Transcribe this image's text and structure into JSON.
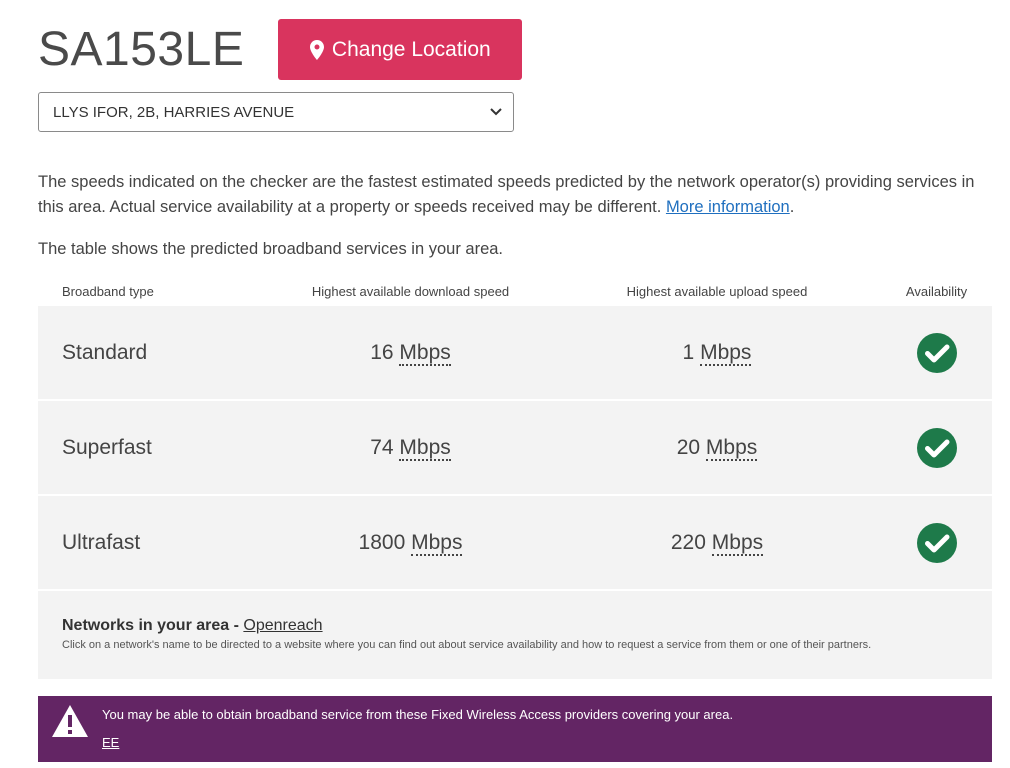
{
  "header": {
    "postcode": "SA153LE",
    "change_location_label": "Change Location"
  },
  "address_select": {
    "selected": "LLYS IFOR, 2B, HARRIES AVENUE"
  },
  "intro": {
    "text": "The speeds indicated on the checker are the fastest estimated speeds predicted by the network operator(s) providing services in this area. Actual service availability at a property or speeds received may be different. ",
    "more_info_link": "More information",
    "period": "."
  },
  "table_caption": "The table shows the predicted broadband services in your area.",
  "table": {
    "headers": [
      "Broadband type",
      "Highest available download speed",
      "Highest available upload speed",
      "Availability"
    ],
    "rows": [
      {
        "type": "Standard",
        "download": "16",
        "download_unit": "Mbps",
        "upload": "1",
        "upload_unit": "Mbps",
        "available": true
      },
      {
        "type": "Superfast",
        "download": "74",
        "download_unit": "Mbps",
        "upload": "20",
        "upload_unit": "Mbps",
        "available": true
      },
      {
        "type": "Ultrafast",
        "download": "1800",
        "download_unit": "Mbps",
        "upload": "220",
        "upload_unit": "Mbps",
        "available": true
      }
    ]
  },
  "networks": {
    "title": "Networks in your area - ",
    "operator": "Openreach",
    "note": "Click on a network's name to be directed to a website where you can find out about service availability and how to request a service from them or one of their partners."
  },
  "warning": {
    "text": "You may be able to obtain broadband service from these Fixed Wireless Access providers covering your area.",
    "provider": "EE"
  },
  "colors": {
    "accent": "#d9345e",
    "check": "#1e7a4a",
    "banner": "#632564",
    "link": "#1f6fbf"
  },
  "icons": {
    "location": "map-pin-icon",
    "available": "check-circle-icon",
    "warning": "warning-triangle-icon",
    "select": "chevron-down-icon"
  }
}
